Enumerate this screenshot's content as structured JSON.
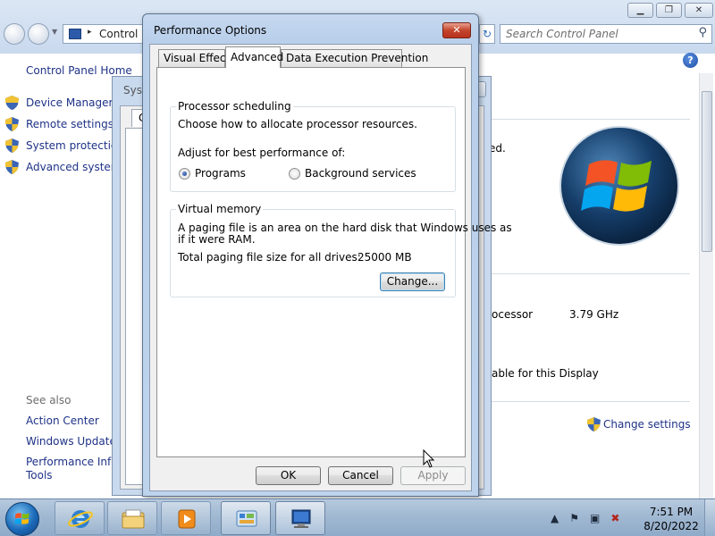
{
  "control_panel": {
    "address_text": "Control P",
    "search_placeholder": "Search Control Panel",
    "sidebar": {
      "home": "Control Panel Home",
      "items": [
        {
          "label": "Device Manager"
        },
        {
          "label": "Remote settings"
        },
        {
          "label": "System protection"
        },
        {
          "label": "Advanced system"
        }
      ],
      "see_also": "See also",
      "links": [
        {
          "label": "Action Center"
        },
        {
          "label": "Windows Update"
        },
        {
          "label": "Performance Infor"
        },
        {
          "label": "Tools"
        }
      ]
    },
    "main": {
      "fragment_ed": "ed.",
      "processor_label": "ocessor",
      "processor_speed": "3.79 GHz",
      "display_text": "able for this Display",
      "change_settings": "Change settings"
    }
  },
  "system_properties": {
    "title": "Syst",
    "tab_fragment": "Co"
  },
  "performance_options": {
    "title": "Performance Options",
    "close_glyph": "✕",
    "tabs": [
      {
        "label": "Visual Effects",
        "selected": false
      },
      {
        "label": "Advanced",
        "selected": true
      },
      {
        "label": "Data Execution Prevention",
        "selected": false
      }
    ],
    "processor_scheduling": {
      "title": "Processor scheduling",
      "description": "Choose how to allocate processor resources.",
      "adjust_label": "Adjust for best performance of:",
      "options": [
        {
          "label": "Programs",
          "checked": true
        },
        {
          "label": "Background services",
          "checked": false
        }
      ]
    },
    "virtual_memory": {
      "title": "Virtual memory",
      "description_line1": "A paging file is an area on the hard disk that Windows uses as",
      "description_line2": "if it were RAM.",
      "total_label": "Total paging file size for all drives:",
      "total_value": "25000 MB",
      "change_button": "Change..."
    },
    "buttons": {
      "ok": "OK",
      "cancel": "Cancel",
      "apply": "Apply"
    }
  },
  "taskbar": {
    "time": "7:51 PM",
    "date": "8/20/2022"
  },
  "colors": {
    "link": "#1e3287",
    "accent": "#3c7fb1",
    "dialog_frame": "#bed3ec",
    "taskbar": "#9fb7d1"
  }
}
